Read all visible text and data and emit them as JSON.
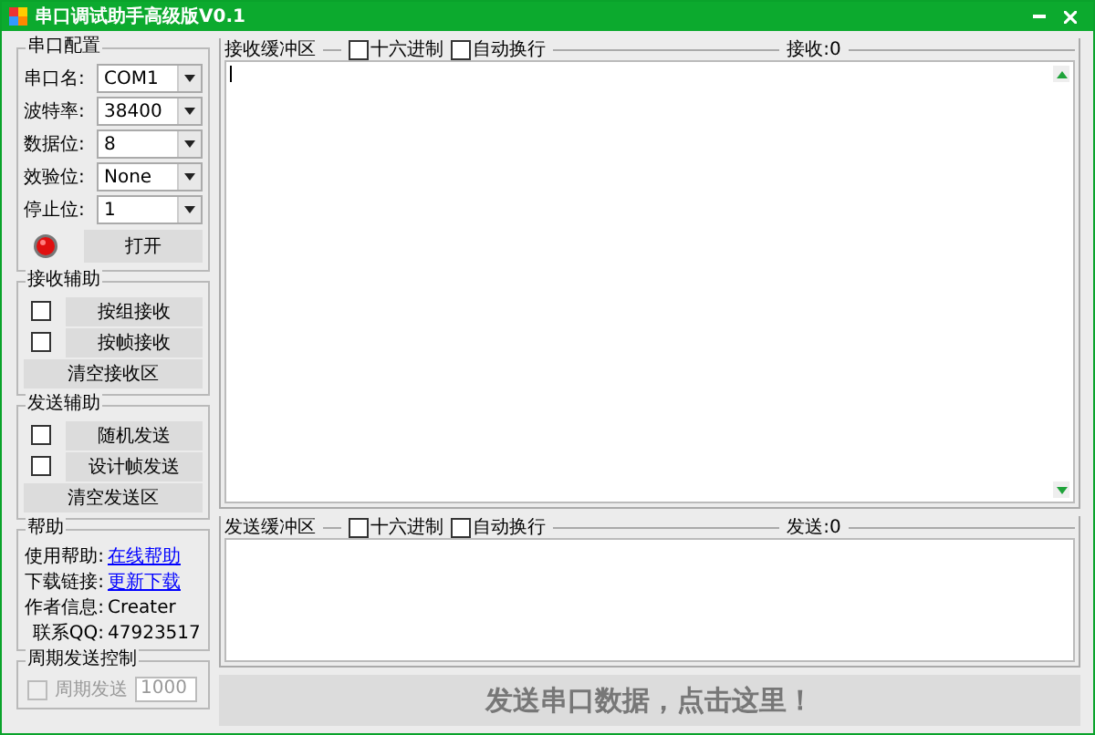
{
  "window": {
    "title": "串口调试助手高级版V0.1"
  },
  "port_config": {
    "title": "串口配置",
    "fields": [
      {
        "label": "串口名:",
        "value": "COM1"
      },
      {
        "label": "波特率:",
        "value": "38400"
      },
      {
        "label": "数据位:",
        "value": "8"
      },
      {
        "label": "效验位:",
        "value": "None"
      },
      {
        "label": "停止位:",
        "value": "1"
      }
    ],
    "open_button": "打开"
  },
  "receive_assist": {
    "title": "接收辅助",
    "items": [
      {
        "kind": "checkbox_button",
        "label": "按组接收",
        "checked": false
      },
      {
        "kind": "checkbox_button",
        "label": "按帧接收",
        "checked": false
      },
      {
        "kind": "button",
        "label": "清空接收区"
      }
    ]
  },
  "send_assist": {
    "title": "发送辅助",
    "items": [
      {
        "kind": "checkbox_button",
        "label": "随机发送",
        "checked": false
      },
      {
        "kind": "checkbox_button",
        "label": "设计帧发送",
        "checked": false
      },
      {
        "kind": "button",
        "label": "清空发送区"
      }
    ]
  },
  "help": {
    "title": "帮助",
    "rows": [
      {
        "kind": "link",
        "label": "使用帮助:",
        "value": "在线帮助"
      },
      {
        "kind": "link",
        "label": "下载链接:",
        "value": "更新下载"
      },
      {
        "kind": "text",
        "label": "作者信息:",
        "value": "Creater"
      },
      {
        "kind": "text",
        "label": "联系QQ:",
        "value": "47923517"
      }
    ]
  },
  "periodic_send": {
    "title": "周期发送控制",
    "checkbox": {
      "label": "周期发送",
      "checked": false,
      "disabled": true
    },
    "interval": "1000"
  },
  "receive_buffer": {
    "title": "接收缓冲区",
    "options": [
      {
        "label": "十六进制",
        "checked": false
      },
      {
        "label": "自动换行",
        "checked": false
      }
    ],
    "counter": "接收:0"
  },
  "send_buffer": {
    "title": "发送缓冲区",
    "options": [
      {
        "label": "十六进制",
        "checked": false
      },
      {
        "label": "自动换行",
        "checked": false
      }
    ],
    "counter": "发送:0"
  },
  "send_button": "发送串口数据，点击这里！"
}
